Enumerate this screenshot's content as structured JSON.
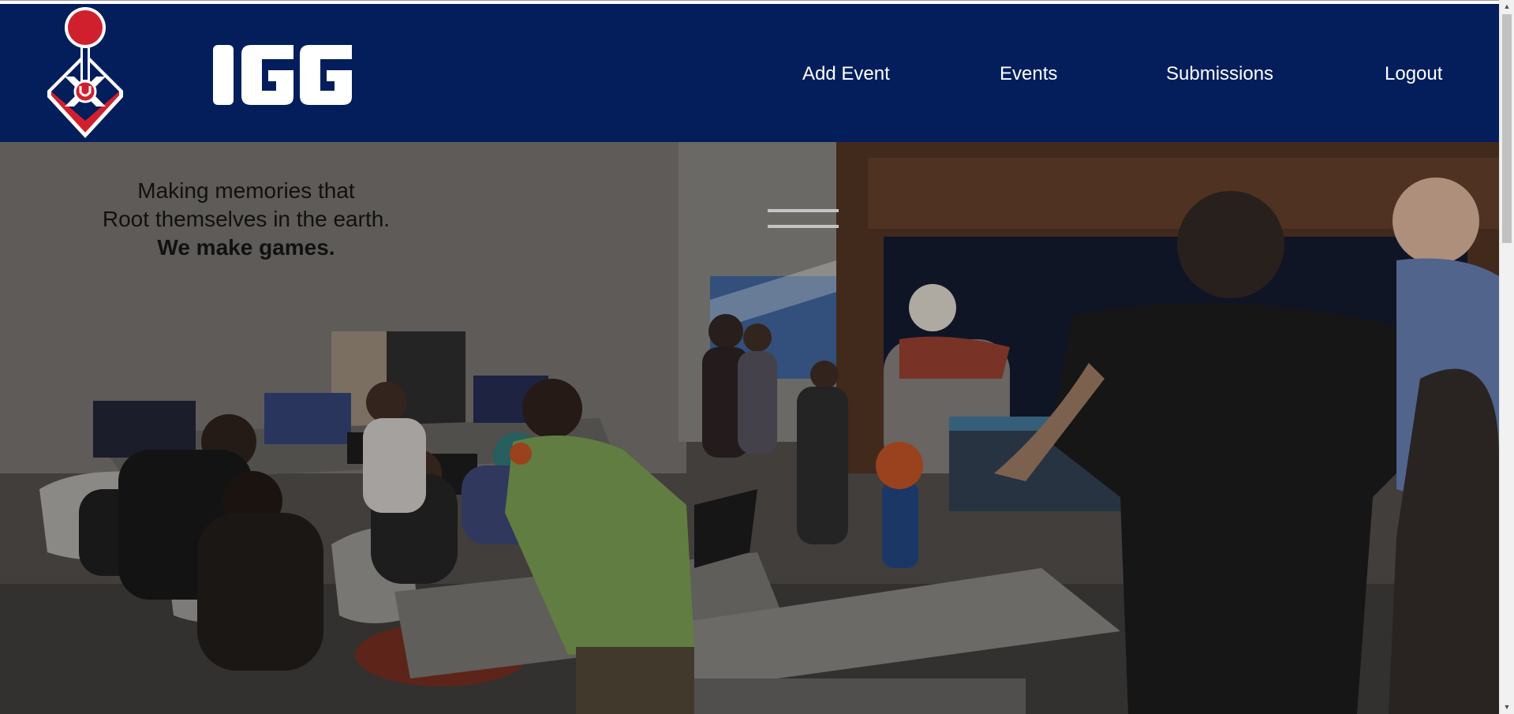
{
  "header": {
    "logo_alt": "IGG",
    "nav": [
      {
        "label": "Add Event"
      },
      {
        "label": "Events"
      },
      {
        "label": "Submissions"
      },
      {
        "label": "Logout"
      }
    ]
  },
  "hero": {
    "line1": "Making memories that",
    "line2": "Root themselves in the earth.",
    "line3": "We make games."
  },
  "colors": {
    "navbar": "#031e5b",
    "logo_red": "#d0202e",
    "logo_white": "#ffffff"
  },
  "icons": {
    "logo": "joystick-logo-icon",
    "scroll_up": "scroll-up-arrow-icon",
    "scroll_down": "scroll-down-arrow-icon"
  }
}
